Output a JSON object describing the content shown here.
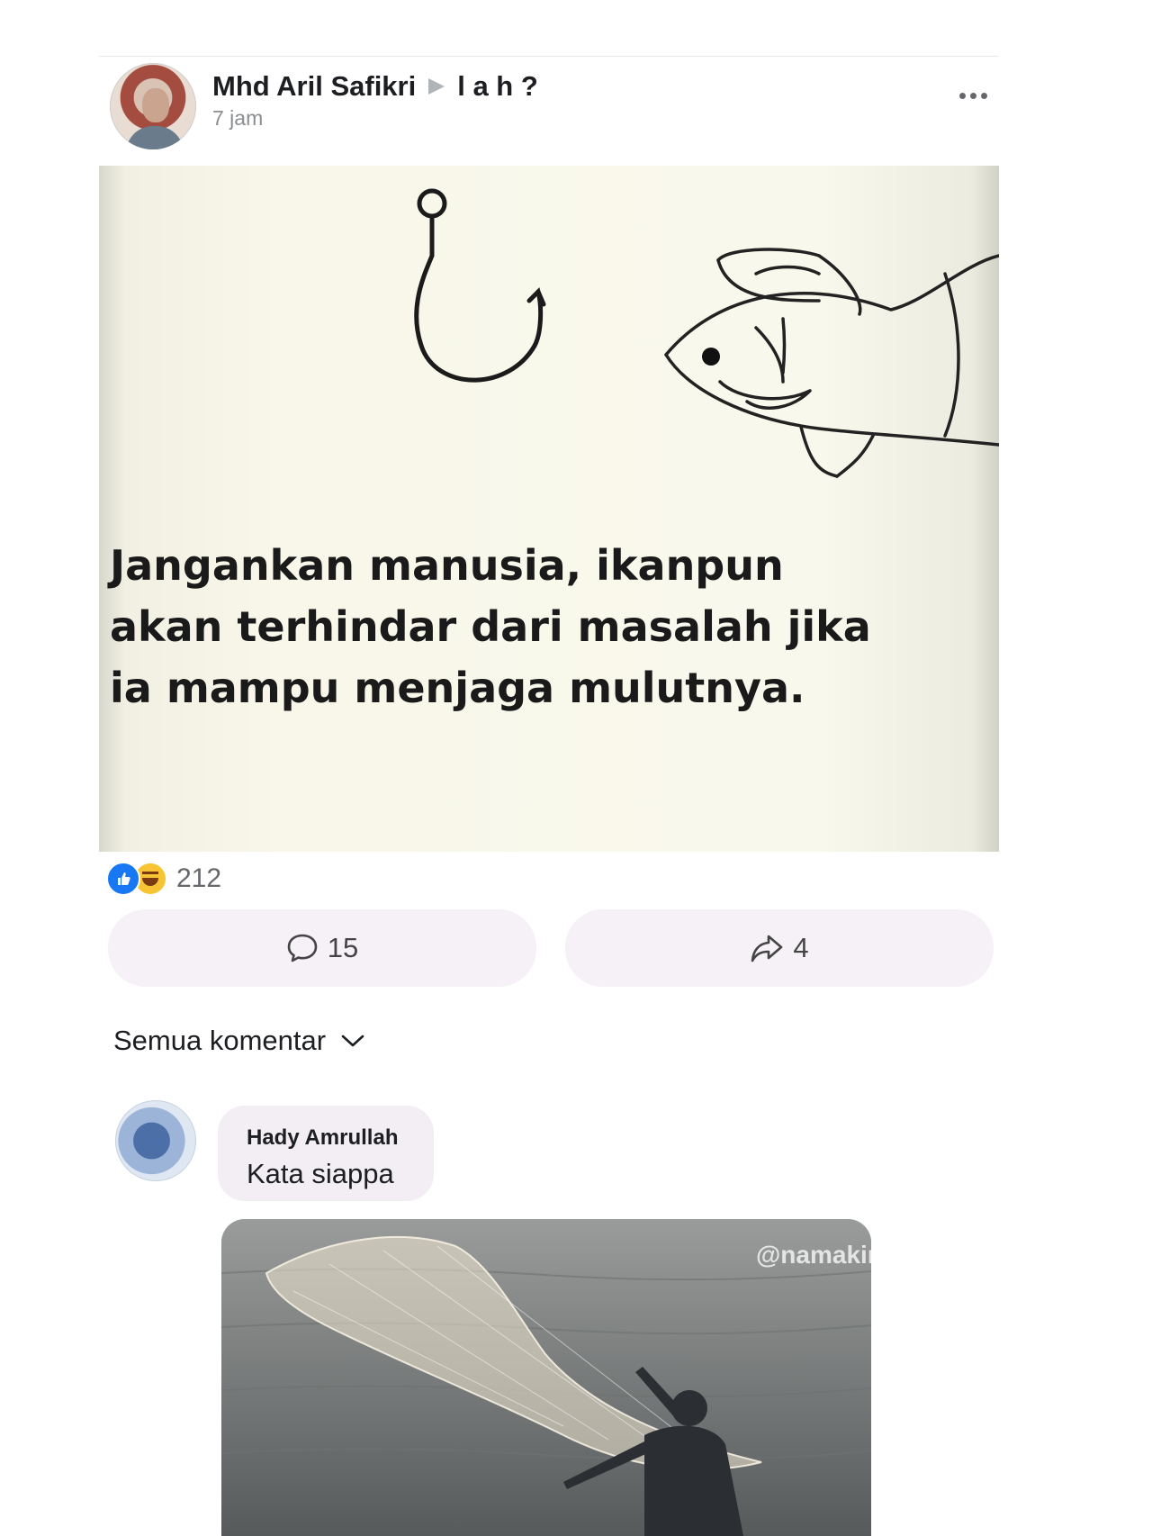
{
  "post": {
    "author": "Mhd Aril Safikri",
    "target": "l a h ?",
    "timestamp": "7 jam",
    "image_text": [
      "Jangankan manusia, ikanpun",
      "akan terhindar dari masalah jika",
      "ia mampu menjaga mulutnya."
    ],
    "reaction_icons": [
      "like-icon",
      "haha-icon"
    ],
    "reaction_count": "212",
    "comment_count": "15",
    "share_count": "4"
  },
  "comments_filter": {
    "label": "Semua komentar"
  },
  "comment": {
    "author": "Hady Amrullah",
    "text": "Kata siappa",
    "watermark": "@namakinaya"
  },
  "colors": {
    "like_blue": "#1877f2",
    "haha_yellow": "#f7c534",
    "button_bg": "#f6f1f7",
    "bubble_bg": "#f3eef4"
  }
}
